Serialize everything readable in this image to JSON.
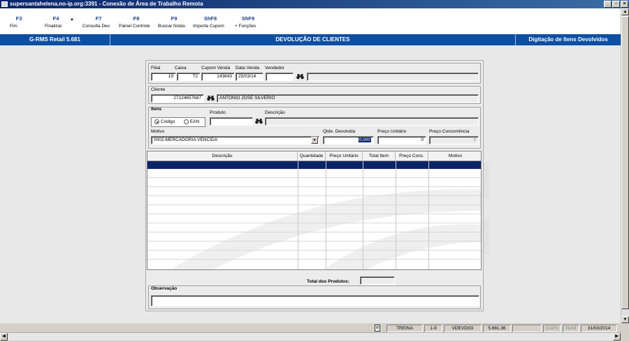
{
  "window": {
    "title": "supersantahelena.no-ip.org:3391 - Conexão de Área de Trabalho Remota",
    "buttons": [
      "_",
      "▫",
      "×"
    ]
  },
  "toolbar": [
    {
      "key": "F3",
      "label": "Fim"
    },
    {
      "key": "F4",
      "label": "Finalizar"
    },
    {
      "key": "F7",
      "label": "Consulta Dev"
    },
    {
      "key": "F8",
      "label": "Painel Controle"
    },
    {
      "key": "F9",
      "label": "Buscar Notas"
    },
    {
      "key": "ShF8",
      "label": "Importa Cupom"
    },
    {
      "key": "ShF9",
      "label": "+ Funções"
    }
  ],
  "header": {
    "app": "G-RMS Retail 5.681",
    "title": "DEVOLUÇÃO DE CLIENTES",
    "right": "Digitação de Itens Devolvidos"
  },
  "form": {
    "filial_label": "Filial",
    "filial": "19",
    "caixa_label": "Caixa",
    "caixa": "72",
    "cupom_label": "Cupom Venda",
    "cupom": "143643",
    "data_label": "Data Venda",
    "data": "25/03/14",
    "vendedor_label": "Vendedor",
    "vendedor": "",
    "vendedor_nome": "",
    "cliente_label": "Cliente",
    "cliente": "27124657687",
    "cliente_nome": "ANTONIO JOSE SILVERIO",
    "itens_label": "Itens",
    "radio_codigo": "Código",
    "radio_ean": "EAN",
    "produto_label": "Produto",
    "produto": "",
    "descricao_label": "Descrição",
    "descricao": "",
    "motivo_label": "Motivo",
    "motivo": "0002-MERCADORIA VENCIDA",
    "qtde_label": "Qtde. Devolvida",
    "qtde": "0,000",
    "preco_unit_label": "Preço Unitário",
    "preco_unit": "0",
    "preco_conc_label": "Preço Concorrência",
    "preco_conc": "0",
    "total_label": "Total dos Produtos:",
    "total": "",
    "obs_label": "Observação",
    "obs": ""
  },
  "grid": {
    "columns": [
      "Descrição",
      "Quantidade",
      "Preço Unitário",
      "Total Item",
      "Preço Conc.",
      "Motivo"
    ]
  },
  "status": {
    "mode": "TREINA",
    "range": "1-9",
    "program": "VDEVDIGI",
    "version": "5.681.36",
    "caps": "CAPS",
    "num": "NUM",
    "date": "31/03/2014"
  }
}
